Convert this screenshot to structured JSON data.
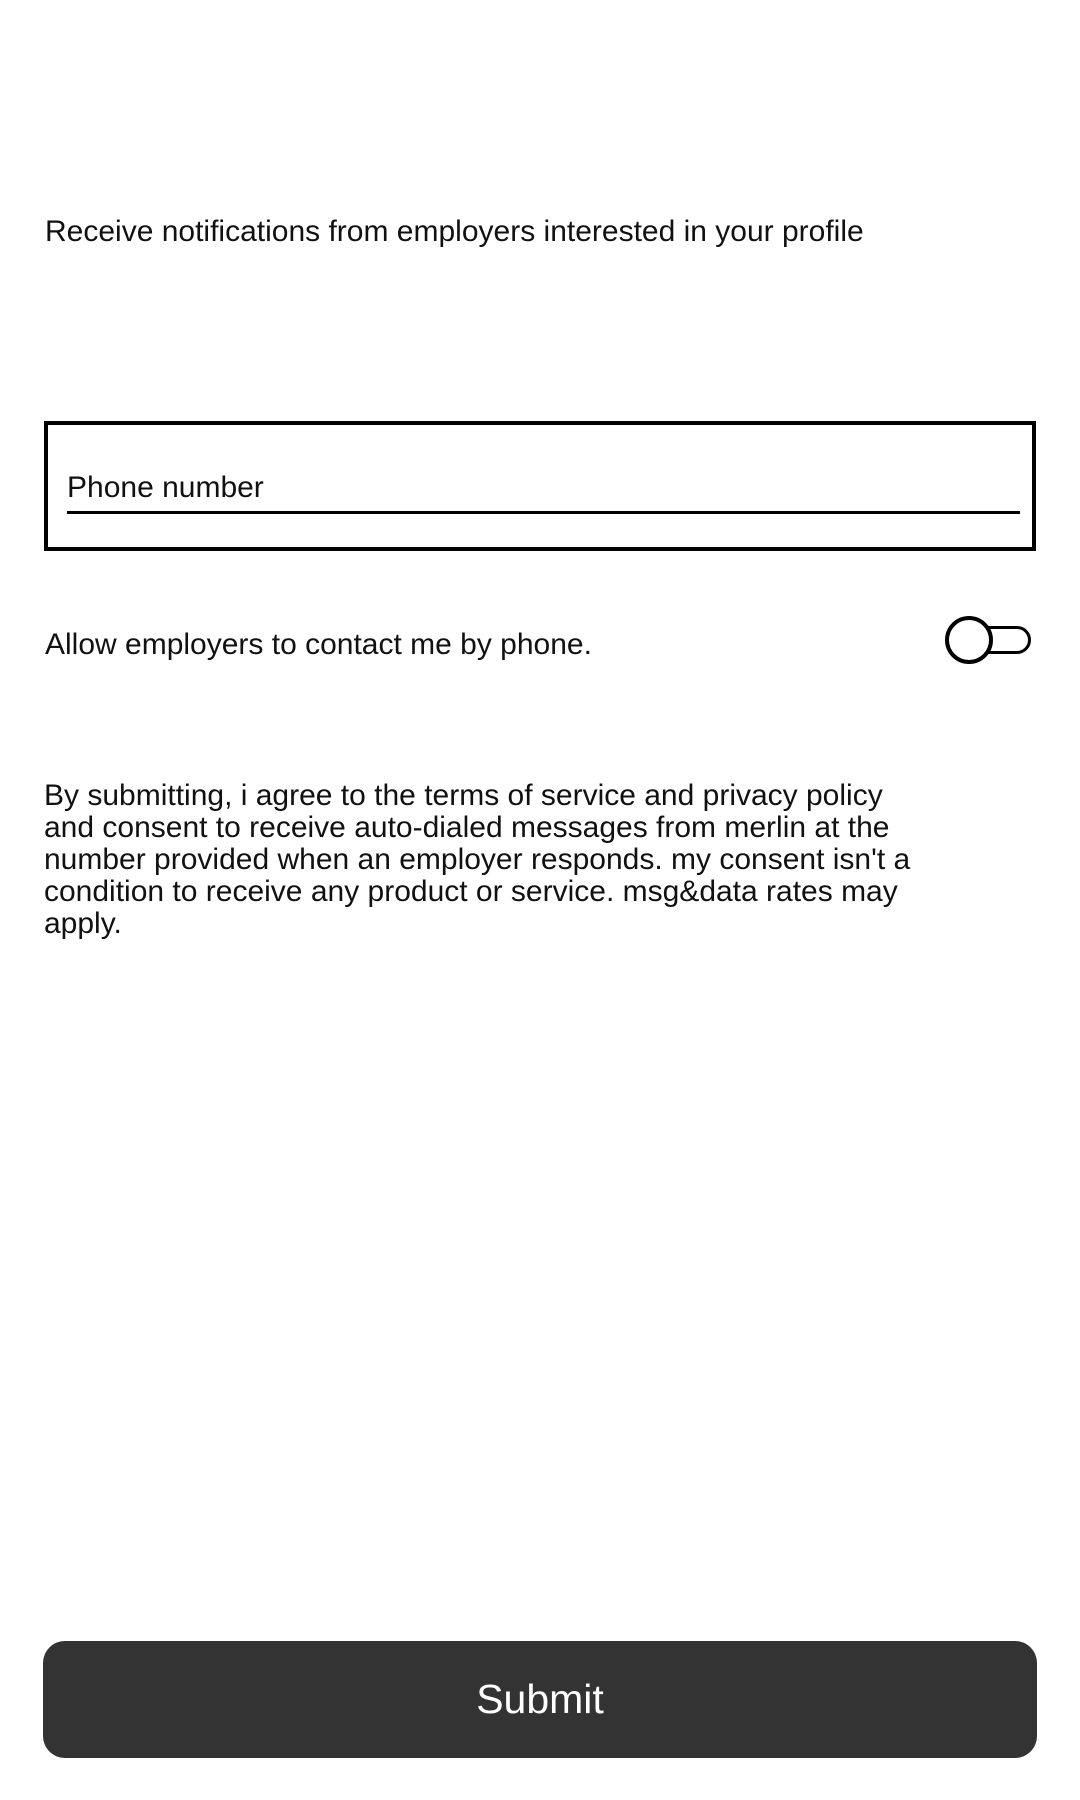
{
  "notifications": {
    "text": "Receive notifications from employers interested in your profile"
  },
  "phone_field": {
    "placeholder": "Phone number",
    "value": ""
  },
  "contact_by_phone": {
    "label": "Allow employers to contact me by phone.",
    "enabled": false
  },
  "consent": {
    "text": "By submitting, i agree to the terms of service and privacy policy and consent to receive auto-dialed messages from merlin at the number provided when an employer responds. my consent isn't a condition to receive any product or service. msg&data rates may apply."
  },
  "submit": {
    "label": "Submit"
  },
  "colors": {
    "button_background": "#333333",
    "button_text": "#ffffff",
    "text": "#111111",
    "border": "#000000"
  }
}
